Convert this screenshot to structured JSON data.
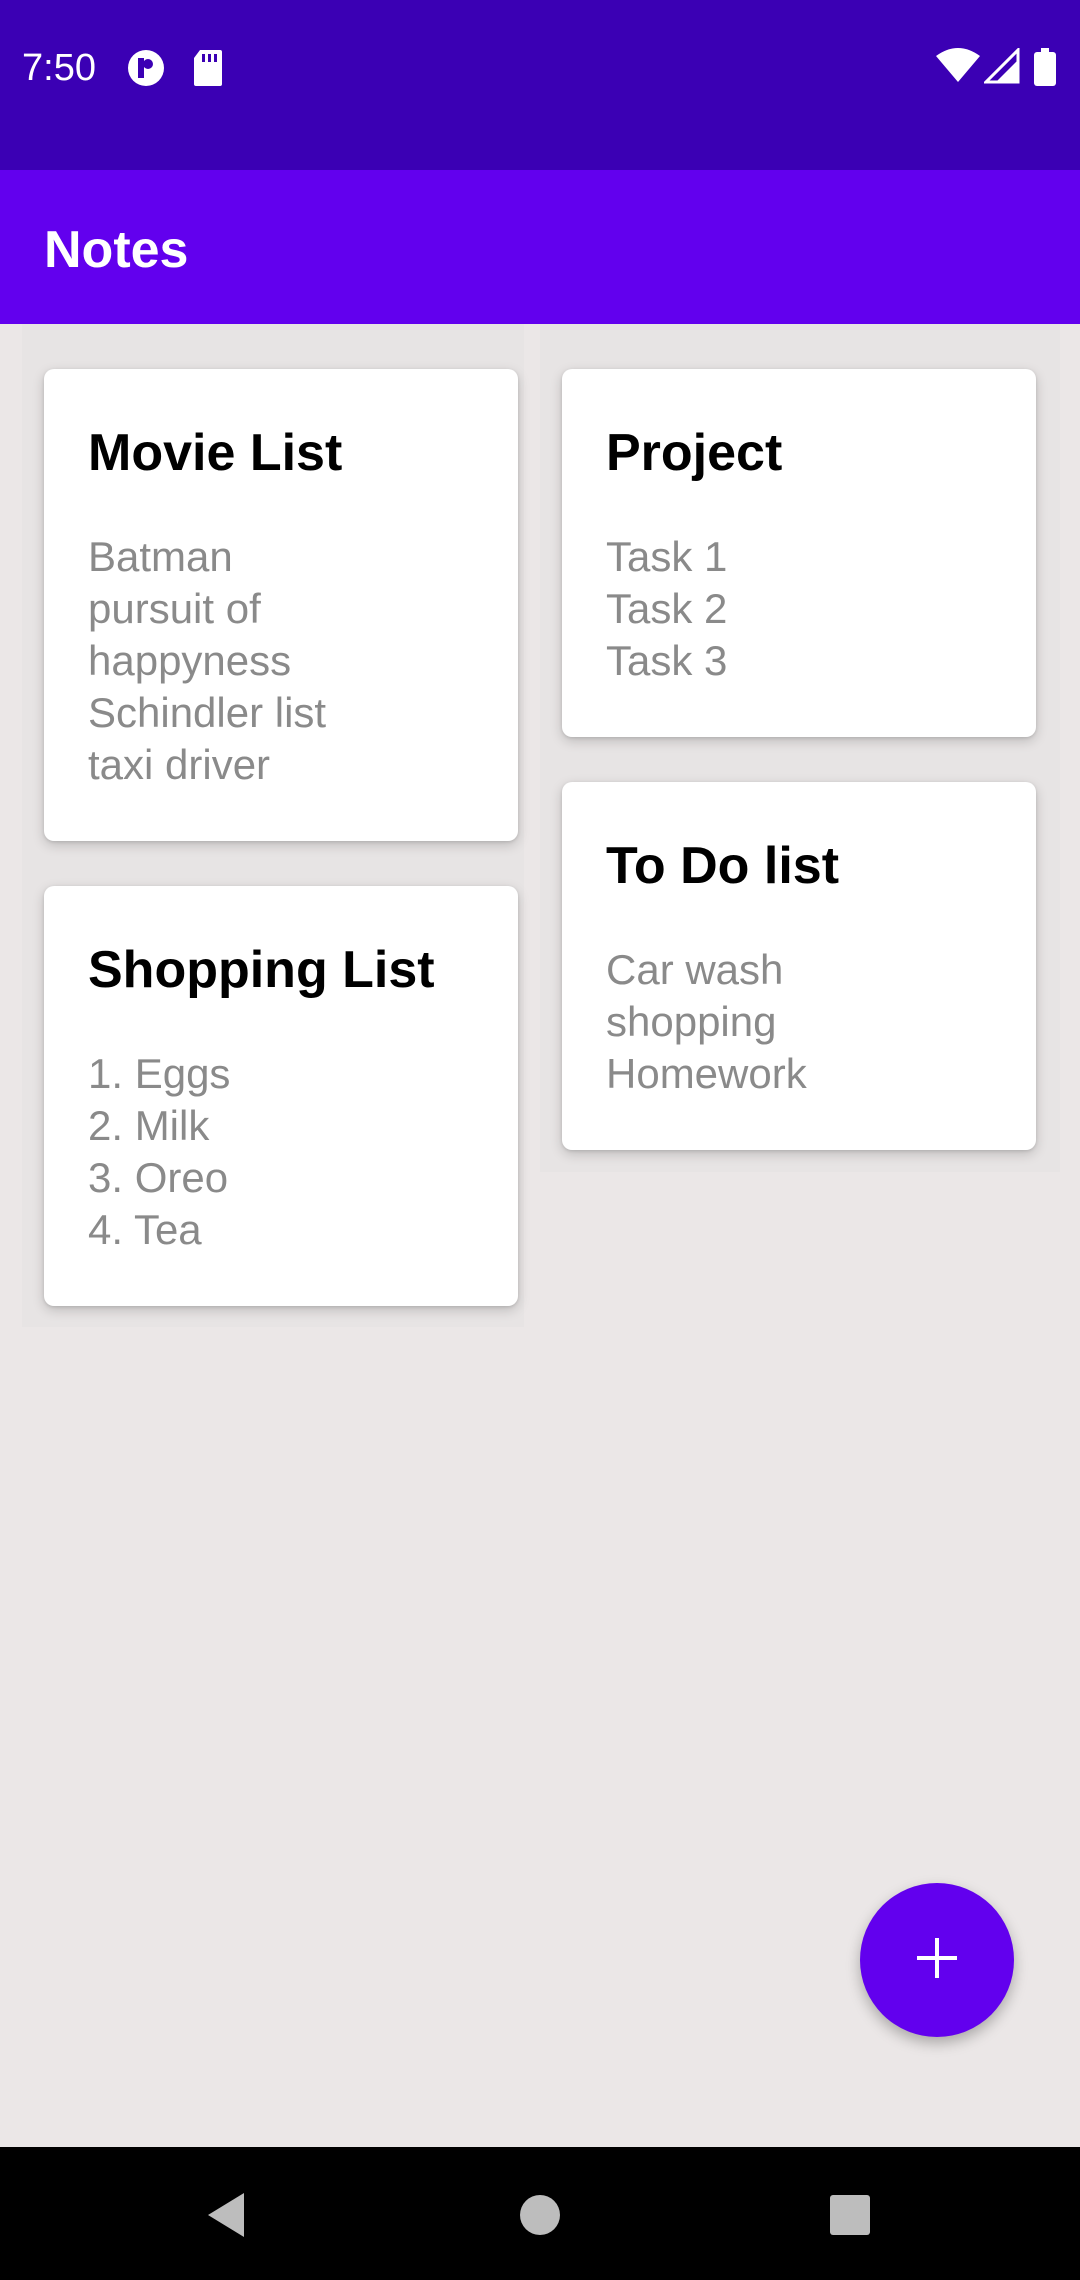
{
  "status_bar": {
    "time": "7:50",
    "left_icons": [
      "app-notification-icon",
      "sd-card-icon"
    ],
    "right_icons": [
      "wifi-icon",
      "cell-signal-icon",
      "battery-icon"
    ],
    "background_color": "#3b00b4"
  },
  "app_bar": {
    "title": "Notes",
    "background_color": "#6200ee"
  },
  "notes": [
    {
      "title": "Movie List",
      "lines": [
        "Batman",
        "pursuit of",
        "happyness",
        "Schindler list",
        "taxi driver"
      ]
    },
    {
      "title": "Project",
      "lines": [
        "Task 1",
        "Task 2",
        "Task 3"
      ]
    },
    {
      "title": "Shopping List",
      "lines": [
        "1. Eggs",
        "2. Milk",
        "3. Oreo",
        "4. Tea"
      ]
    },
    {
      "title": "To Do list",
      "lines": [
        "Car wash",
        "shopping",
        "Homework"
      ]
    }
  ],
  "fab": {
    "icon": "plus-icon",
    "color": "#6200ee"
  },
  "nav_bar": {
    "buttons": [
      "back-icon",
      "home-icon",
      "recents-icon"
    ]
  }
}
